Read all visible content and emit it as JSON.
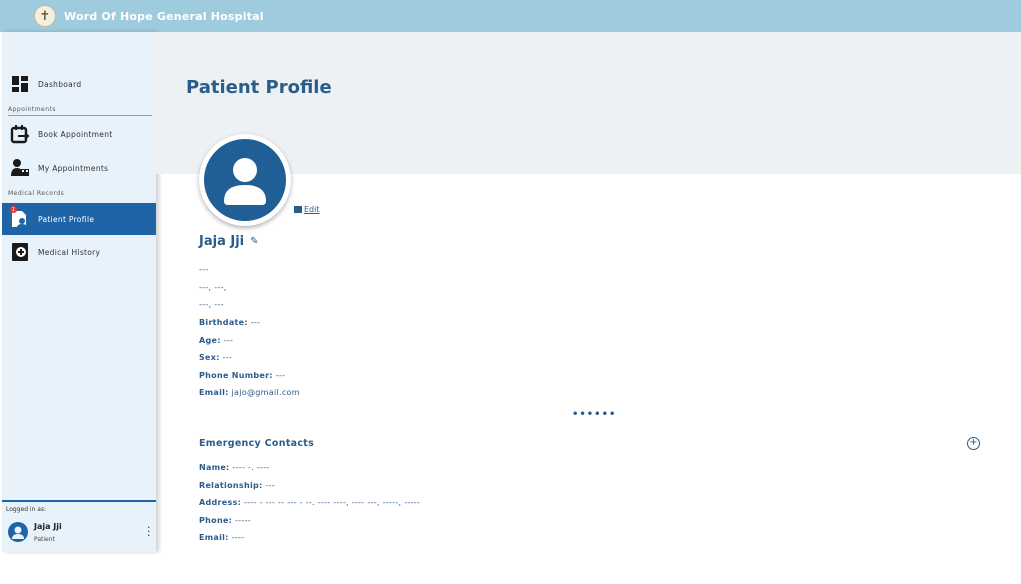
{
  "app": {
    "title": "Word Of Hope General Hospital",
    "logo_icon": "hospital-logo-icon",
    "accent": "#1f64a6",
    "topbar_color": "#9ecbdd"
  },
  "sidebar": {
    "items": [
      {
        "label": "Dashboard",
        "icon": "dashboard-icon"
      },
      {
        "label": "Book Appointment",
        "icon": "calendar-arrow-icon"
      },
      {
        "label": "My Appointments",
        "icon": "doctor-icon"
      },
      {
        "label": "Patient Profile",
        "icon": "patient-profile-icon",
        "active": true
      },
      {
        "label": "Medical History",
        "icon": "medical-book-icon"
      }
    ],
    "sections": {
      "appointments": "Appointments",
      "medical_records": "Medical Records"
    },
    "badge": "1",
    "logged_in_label": "Logged in as:",
    "user_name": "Jaja Jji",
    "user_role": "Patient"
  },
  "main": {
    "page_title": "Patient Profile",
    "edit_label": "Edit",
    "patient_name": "Jaja Jji",
    "info_lines": {
      "line1": "---",
      "line2": "---, ---,",
      "line3": "---, ---"
    },
    "fields": {
      "birthdate_label": "Birthdate:",
      "birthdate_value": "---",
      "age_label": "Age:",
      "age_value": "---",
      "sex_label": "Sex:",
      "sex_value": "---",
      "phone_label": "Phone Number:",
      "phone_value": "---",
      "email_label": "Email:",
      "email_value": "jajo@gmail.com"
    },
    "more_dots": "••••••",
    "emergency": {
      "title": "Emergency Contacts",
      "name_label": "Name:",
      "name_value": "---- -. ----",
      "relationship_label": "Relationship:",
      "relationship_value": "---",
      "address_label": "Address:",
      "address_value": "---- - --- -- --- - --. ---- ----, ---- ---, -----, -----",
      "phone_label": "Phone:",
      "phone_value": "-----",
      "email_label": "Email:",
      "email_value": "----"
    }
  }
}
